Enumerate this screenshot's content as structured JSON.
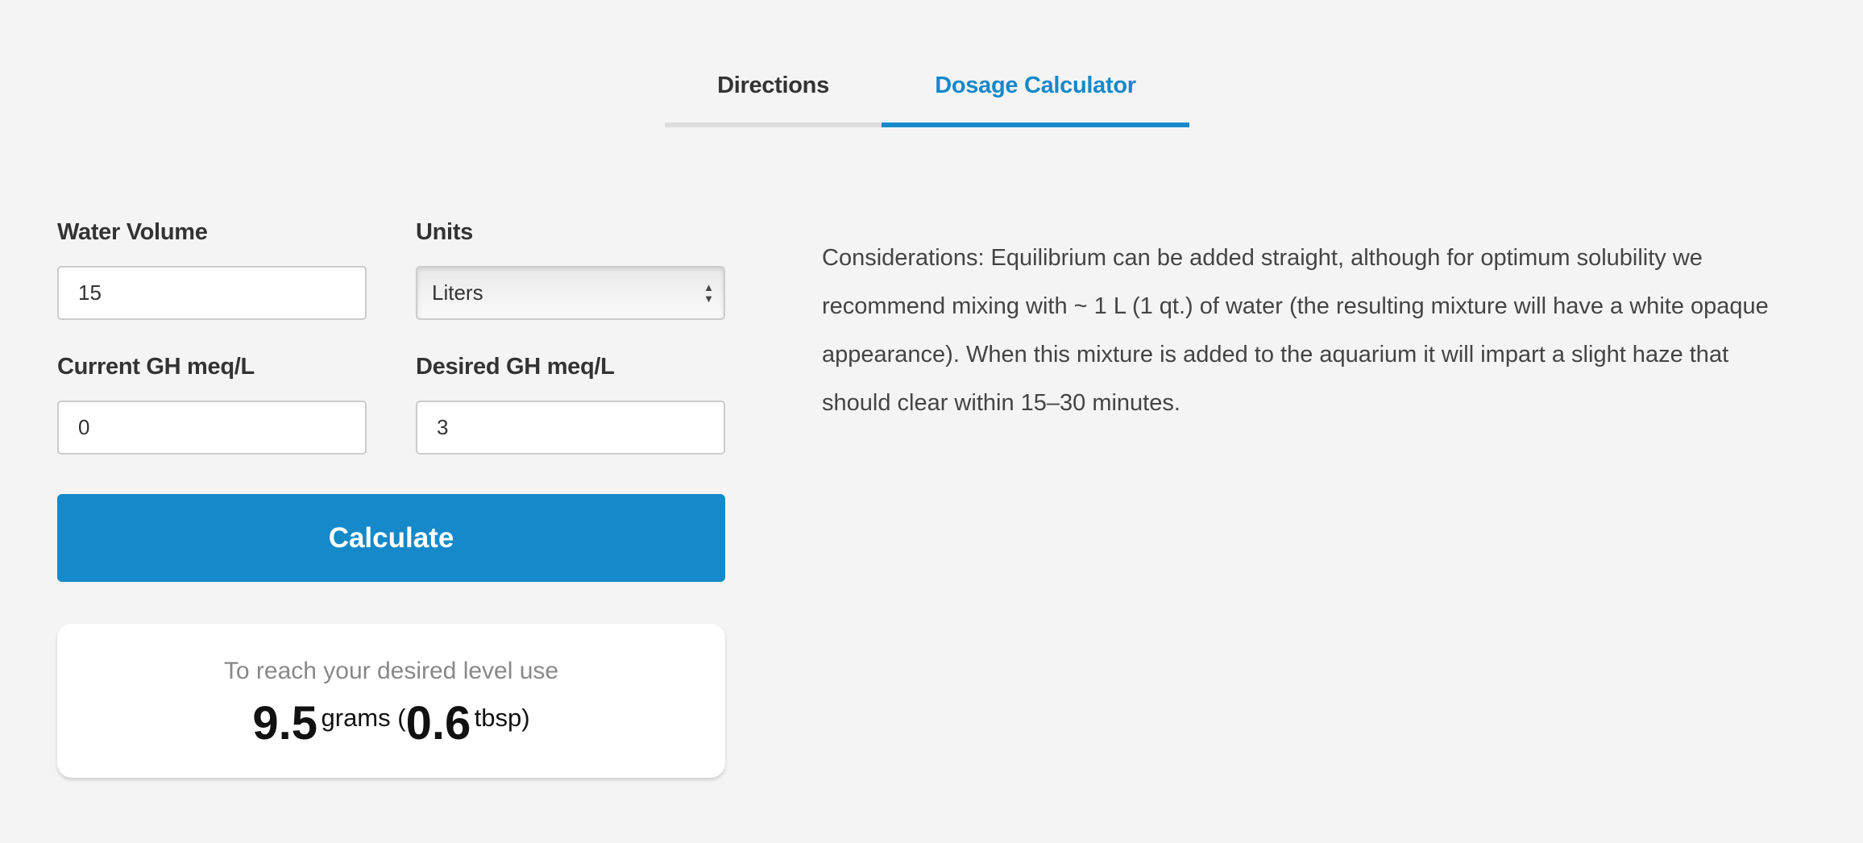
{
  "tabs": [
    {
      "label": "Directions",
      "active": false
    },
    {
      "label": "Dosage Calculator",
      "active": true
    }
  ],
  "form": {
    "water_volume": {
      "label": "Water Volume",
      "value": "15"
    },
    "units": {
      "label": "Units",
      "value": "Liters"
    },
    "current_gh": {
      "label": "Current GH meq/L",
      "value": "0"
    },
    "desired_gh": {
      "label": "Desired GH meq/L",
      "value": "3"
    },
    "calculate_label": "Calculate"
  },
  "result": {
    "intro": "To reach your desired level use",
    "grams": "9.5",
    "grams_unit": "grams (",
    "tbsp": "0.6",
    "tbsp_unit": "tbsp)"
  },
  "considerations": "Considerations: Equilibrium can be added straight, although for optimum solubility we recommend mixing with ~ 1 L (1 qt.) of water (the resulting mixture will have a white opaque appearance). When this mixture is added to the aquarium it will impart a slight haze that should clear within 15–30 minutes.",
  "colors": {
    "accent": "#1589c9",
    "background": "#f4f4f4"
  }
}
